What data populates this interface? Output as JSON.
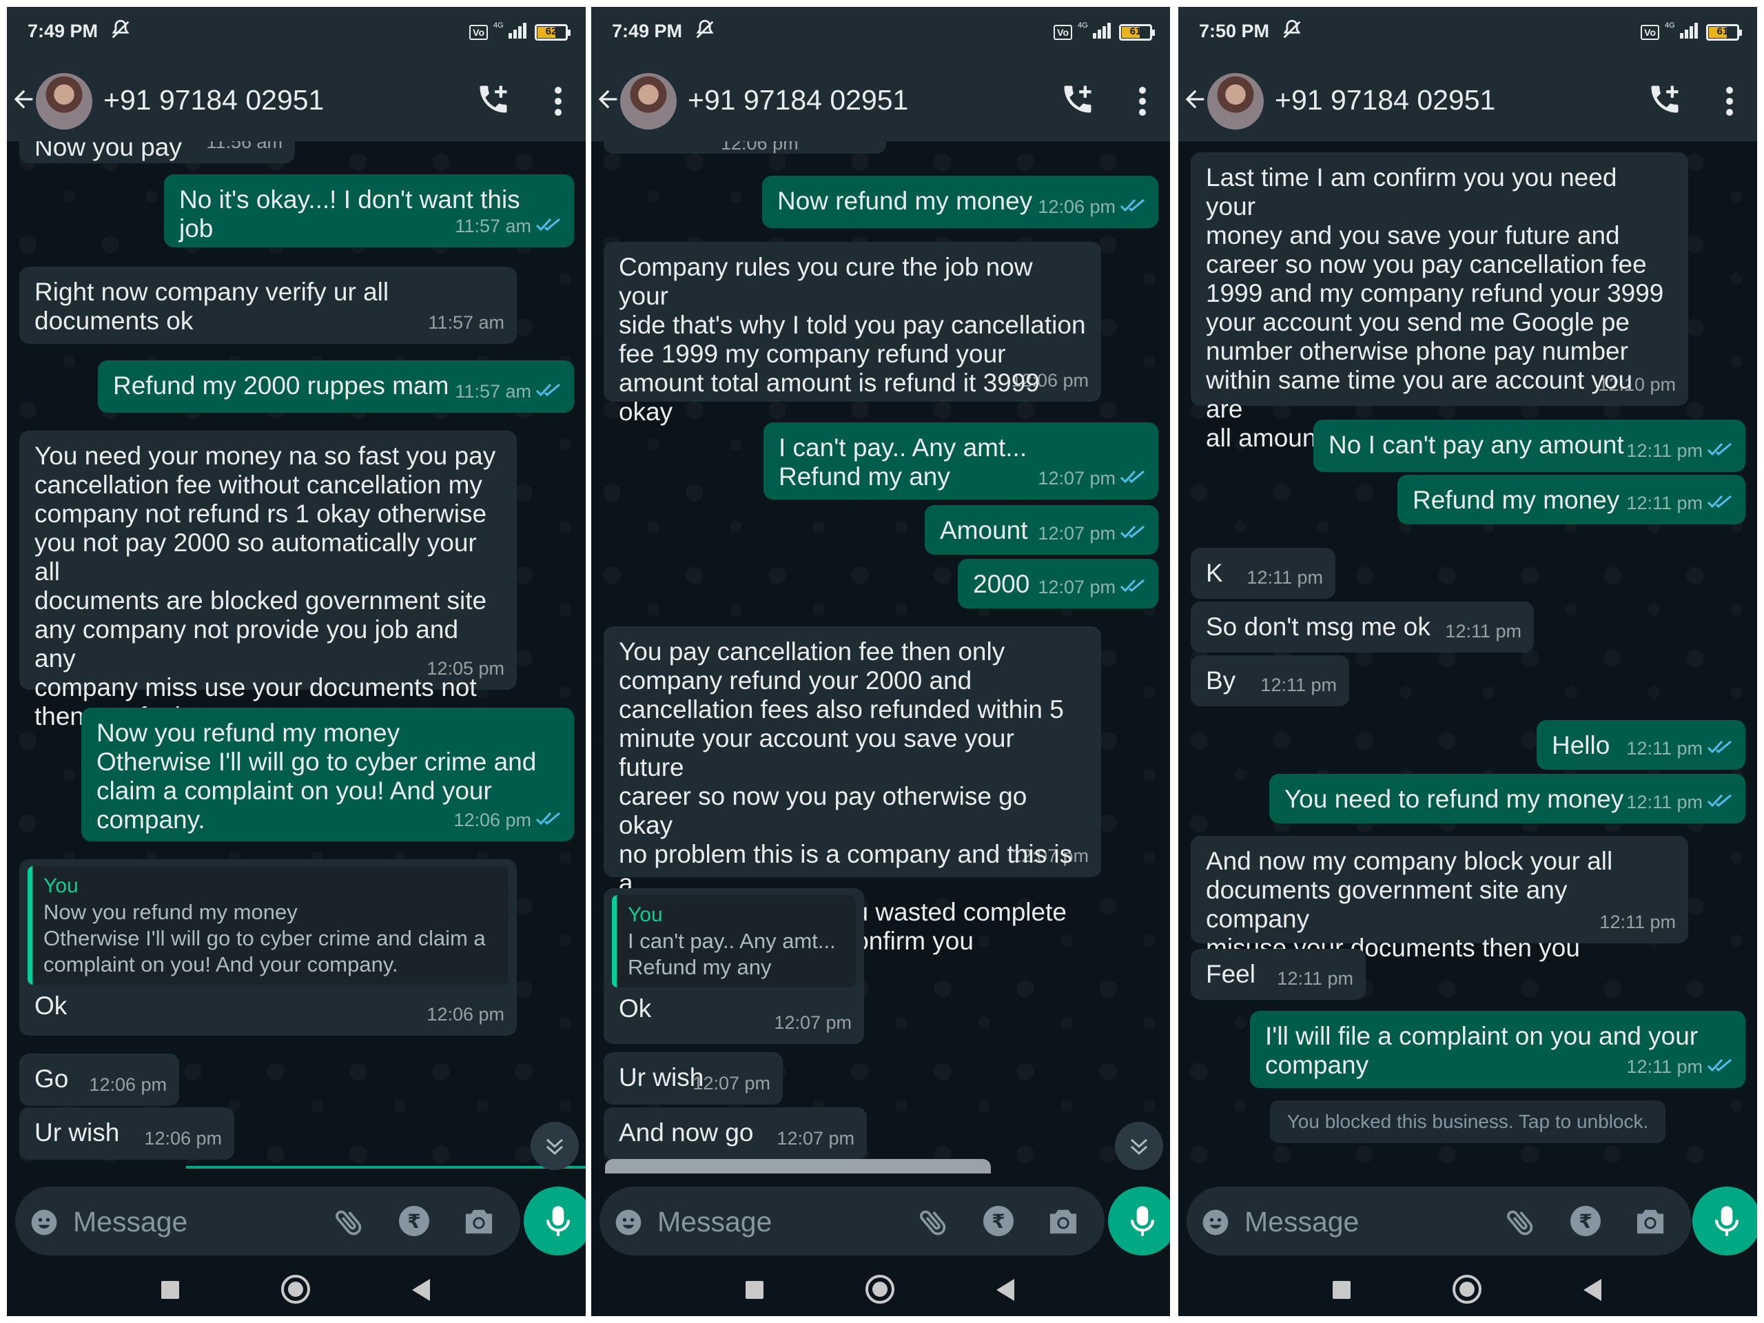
{
  "contact": "+91 97184 02951",
  "input_placeholder": "Message",
  "colors": {
    "incoming": "#202c33",
    "outgoing": "#005c4b",
    "accent": "#00a884",
    "quote_author": "#06cf9c",
    "tick": "#53bdeb"
  },
  "icons": [
    "back-arrow-icon",
    "add-call-icon",
    "more-vert-icon",
    "emoji-icon",
    "attach-icon",
    "rupee-icon",
    "camera-icon",
    "mic-icon",
    "double-check-icon",
    "mute-icon",
    "signal-icon",
    "battery-icon"
  ],
  "screens": [
    {
      "status_time": "7:49 PM",
      "battery": "62",
      "network": "4G",
      "messages": [
        {
          "text": "Now you pay",
          "time": "11:56 am"
        },
        {
          "text": "No it's okay...!  I don't want this job",
          "time": "11:57 am"
        },
        {
          "text": "Right now company verify ur all\ndocuments ok",
          "time": "11:57 am"
        },
        {
          "text": "Refund my 2000 ruppes mam",
          "time": "11:57 am"
        },
        {
          "text": "You need your money na so fast you pay\ncancellation fee without cancellation my\ncompany not refund rs 1 okay otherwise\nyou not pay 2000 so automatically your all\ndocuments are blocked government site\nany company not provide you job and any\ncompany miss use your documents not\nthen you feel",
          "time": "12:05 pm"
        },
        {
          "text": "Now you refund my money\nOtherwise I'll will go to cyber crime and\nclaim a complaint on you!  And your\ncompany.",
          "time": "12:06 pm"
        },
        {
          "quote_author": "You",
          "quote_text": "Now you refund my money\nOtherwise I'll will go to cyber crime and claim a\ncomplaint on you!  And your company.",
          "text": "Ok",
          "time": "12:06 pm"
        },
        {
          "text": "Go",
          "time": "12:06 pm"
        },
        {
          "text": "Ur wish",
          "time": "12:06 pm"
        }
      ]
    },
    {
      "status_time": "7:49 PM",
      "battery": "61",
      "network": "4G",
      "messages": [
        {
          "text": "12:06 pm",
          "time": ""
        },
        {
          "text": "Now refund my money",
          "time": "12:06 pm"
        },
        {
          "text": "Company rules you cure the job now your\nside that's why I told you pay cancellation\nfee 1999 my company refund your\namount total amount is refund it 3999\nokay",
          "time": "12:06 pm"
        },
        {
          "text": "I can't pay.. Any amt...\nRefund my any",
          "time": "12:07 pm"
        },
        {
          "text": "Amount",
          "time": "12:07 pm"
        },
        {
          "text": "2000",
          "time": "12:07 pm"
        },
        {
          "text": "You pay cancellation fee then only\ncompany refund your 2000 and\ncancellation fees also refunded within 5\nminute your account you save your future\ncareer so now you pay otherwise go okay\nno problem this is a company and this is a\ngenuine company you wasted complete\ntime so that's why I confirm you",
          "time": "12:07 pm"
        },
        {
          "quote_author": "You",
          "quote_text": "I can't pay.. Any amt...\nRefund my any",
          "text": "Ok",
          "time": "12:07 pm"
        },
        {
          "text": "Ur wish",
          "time": "12:07 pm"
        },
        {
          "text": "And now go",
          "time": "12:07 pm"
        }
      ]
    },
    {
      "status_time": "7:50 PM",
      "battery": "61",
      "network": "4G",
      "messages": [
        {
          "text": "Last time I am confirm you you need your\nmoney and you save your future and\ncareer so now you pay cancellation fee\n1999 and my company refund your 3999\nyour account you send me Google pe\nnumber otherwise phone pay number\nwithin same time you are account you are\nall amount",
          "time": "12:10 pm"
        },
        {
          "text": "No I can't pay any amount",
          "time": "12:11 pm"
        },
        {
          "text": "Refund my money",
          "time": "12:11 pm"
        },
        {
          "text": "K",
          "time": "12:11 pm"
        },
        {
          "text": "So don't msg me ok",
          "time": "12:11 pm"
        },
        {
          "text": "By",
          "time": "12:11 pm"
        },
        {
          "text": "Hello",
          "time": "12:11 pm"
        },
        {
          "text": "You need to refund my money",
          "time": "12:11 pm"
        },
        {
          "text": "And now my company block your all\ndocuments government site any company\nmisuse your documents then you",
          "time": "12:11 pm"
        },
        {
          "text": "Feel",
          "time": "12:11 pm"
        },
        {
          "text": "I'll will file a complaint on you and your\ncompany",
          "time": "12:11 pm"
        }
      ],
      "system_note": "You blocked this business. Tap to unblock."
    }
  ]
}
